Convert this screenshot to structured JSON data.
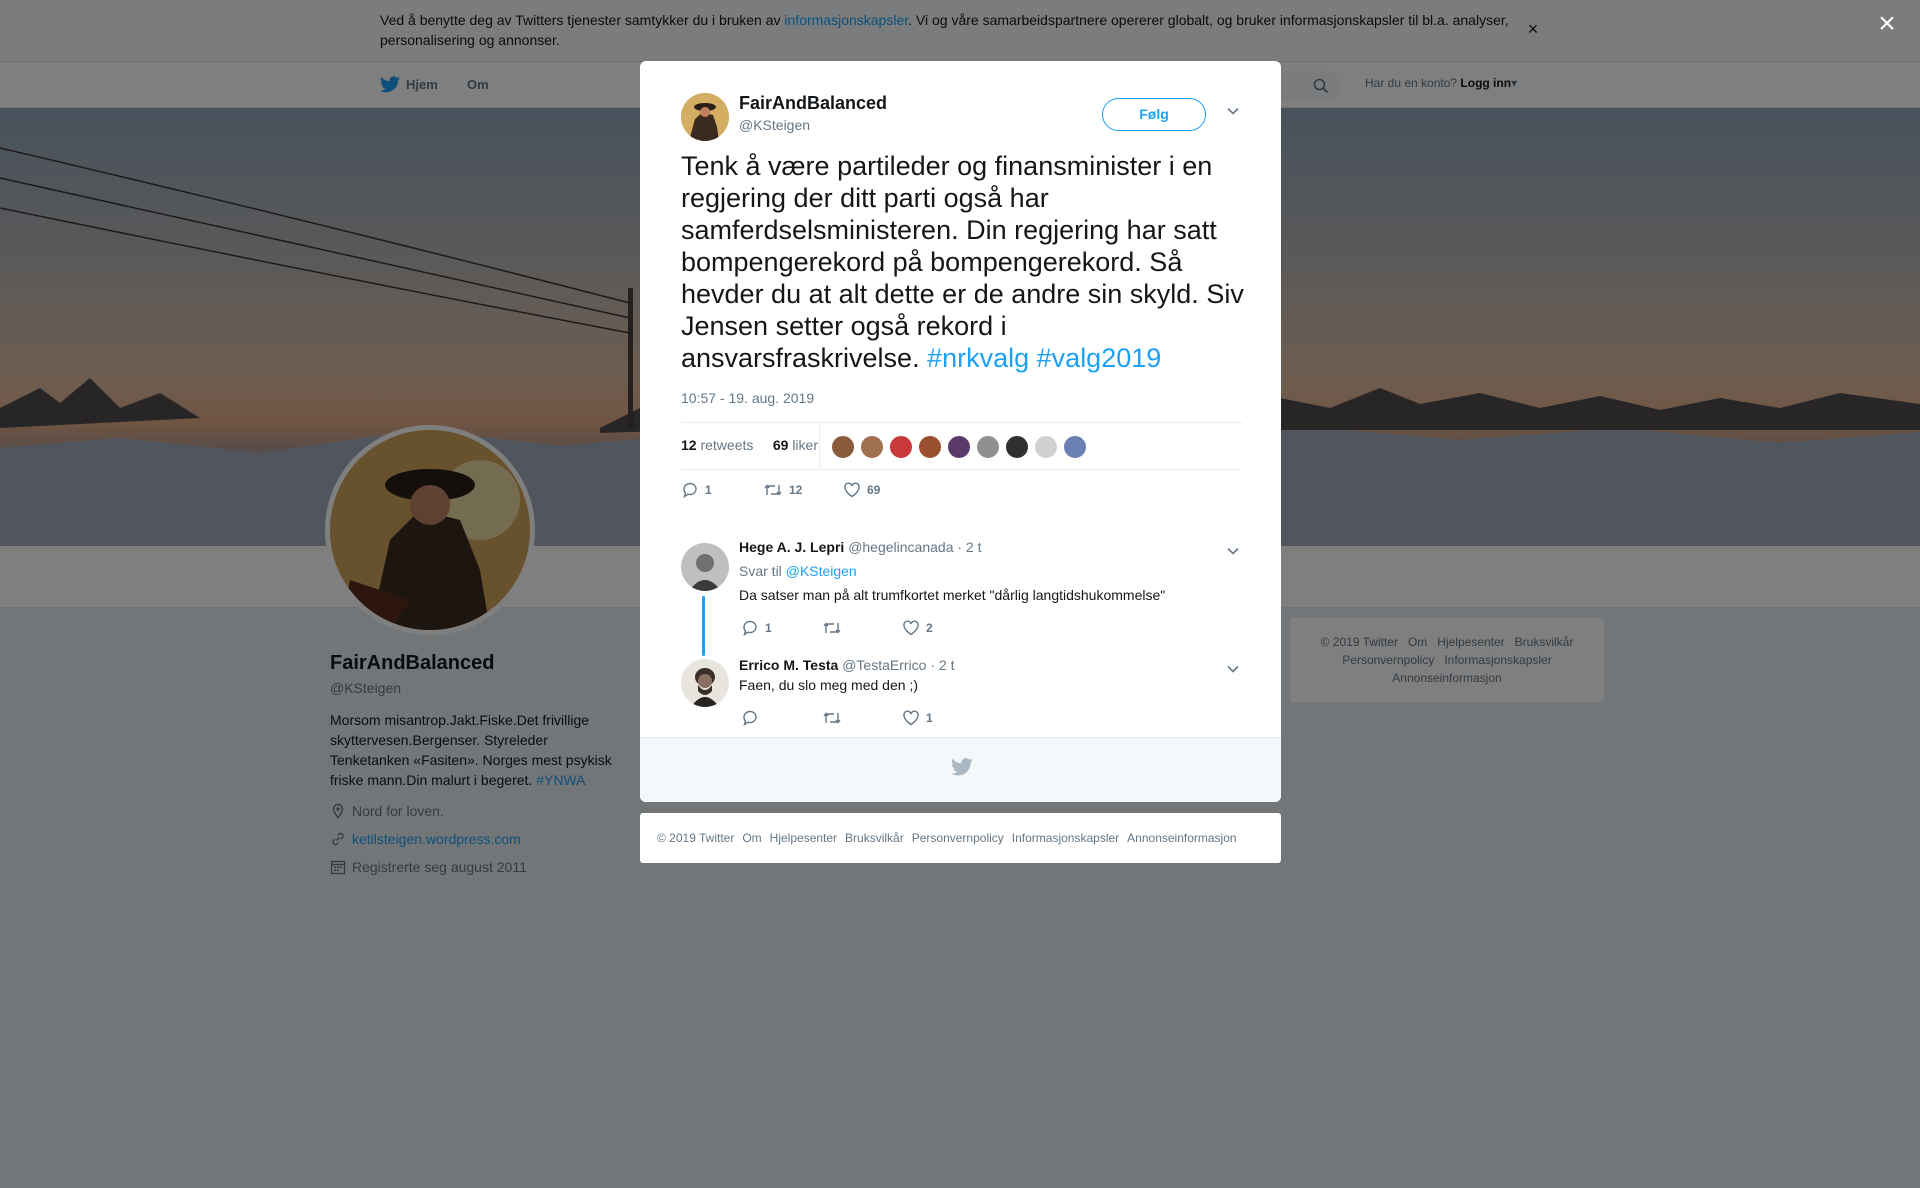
{
  "cookie": {
    "text_before": "Ved å benytte deg av Twitters tjenester samtykker du i bruken av ",
    "link": "informasjonskapsler",
    "text_after": ". Vi og våre samarbeidspartnere opererer globalt, og bruker informasjonskapsler til bl.a. analyser, personalisering og annonser.",
    "close": "×"
  },
  "nav": {
    "home": "Hjem",
    "about": "Om",
    "account_prompt": "Har du en konto?",
    "login": "Logg inn"
  },
  "profile": {
    "name": "FairAndBalanced",
    "handle": "@KSteigen",
    "bio": "Morsom misantrop.Jakt.Fiske.Det frivillige skyttervesen.Bergenser. Styreleder Tenketanken «Fasiten». Norges mest psykisk friske mann.Din malurt i begeret. ",
    "bio_hashtag": "#YNWA",
    "location": "Nord for loven.",
    "website": "ketilsteigen.wordpress.com",
    "joined": "Registrerte seg august 2011"
  },
  "side_footer": {
    "line1": [
      "© 2019 Twitter",
      "Om",
      "Hjelpesenter",
      "Bruksvilkår"
    ],
    "line2": [
      "Personvernpolicy",
      "Informasjonskapsler"
    ],
    "line3": [
      "Annonseinformasjon"
    ]
  },
  "overlay_close": "×",
  "tweet": {
    "author_name": "FairAndBalanced",
    "author_handle": "@KSteigen",
    "follow_label": "Følg",
    "text": "Tenk å være partileder og finansminister i en regjering der ditt parti også har samferdselsministeren. Din regjering har satt bompengerekord på bompengerekord. Så hevder du at alt dette er de andre sin skyld. Siv Jensen setter også rekord i ansvarsfraskrivelse. ",
    "hashtags": [
      "#nrkvalg",
      "#valg2019"
    ],
    "time": "10:57 - 19. aug. 2019",
    "retweets": "12",
    "retweets_label": "retweets",
    "likes": "69",
    "likes_label": "liker",
    "actions": {
      "replies": "1",
      "retweets": "12",
      "likes": "69"
    },
    "liker_colors": [
      "#8a5a3c",
      "#a07050",
      "#c83a3a",
      "#9a5030",
      "#5a3a6a",
      "#909090",
      "#303030",
      "#d0d0d0",
      "#6a80b0"
    ]
  },
  "replies": [
    {
      "name": "Hege A. J. Lepri",
      "handle": "@hegelincanada",
      "time": "· 2 t",
      "reply_to_label": "Svar til",
      "reply_to_handle": "@KSteigen",
      "text": "Da satser man på alt trumfkortet merket \"dårlig langtidshukommelse\"",
      "replies": "1",
      "retweets": "",
      "likes": "2"
    },
    {
      "name": "Errico M. Testa",
      "handle": "@TestaErrico",
      "time": "· 2 t",
      "text": "Faen, du slo meg med den ;)",
      "replies": "",
      "retweets": "",
      "likes": "1"
    }
  ],
  "bottom_footer": [
    "© 2019 Twitter",
    "Om",
    "Hjelpesenter",
    "Bruksvilkår",
    "Personvernpolicy",
    "Informasjonskapsler",
    "Annonseinformasjon"
  ],
  "colors": {
    "accent": "#1da1f2",
    "text": "#14171a",
    "muted": "#657786"
  }
}
